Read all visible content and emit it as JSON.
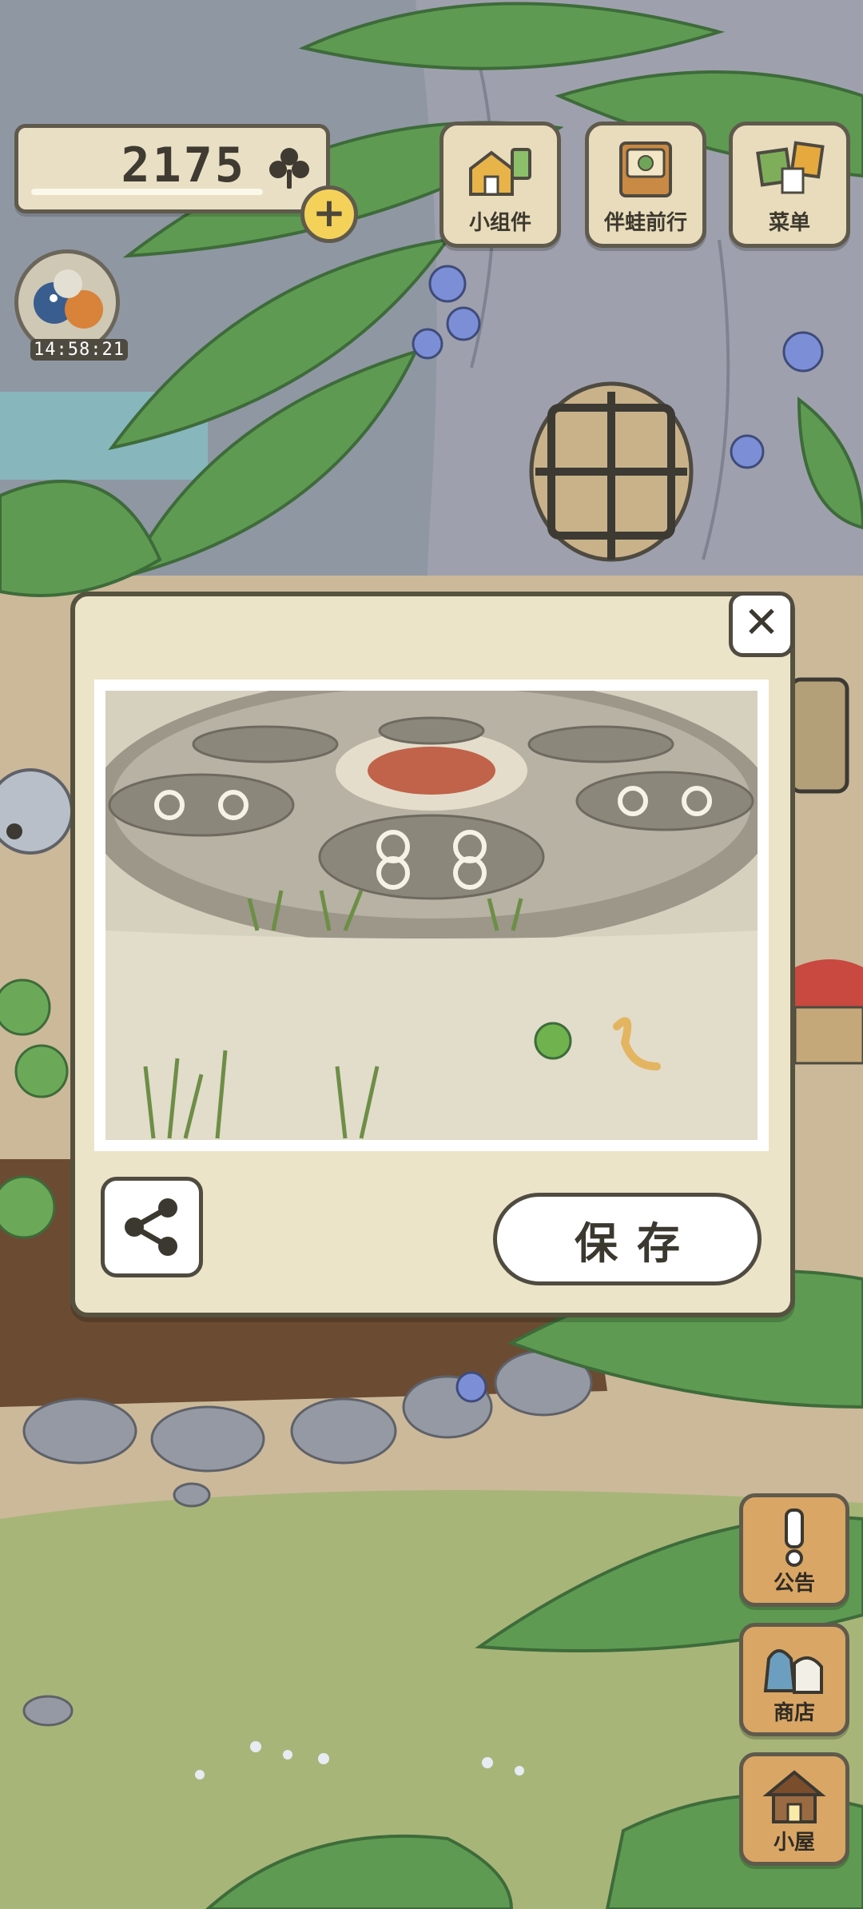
{
  "hud": {
    "clover_count": "2175",
    "timer": "14:58:21"
  },
  "top_buttons": [
    {
      "label": "小组件",
      "icon": "widget-icon"
    },
    {
      "label": "伴蛙前行",
      "icon": "frog-book-icon"
    },
    {
      "label": "菜单",
      "icon": "menu-cards-icon"
    }
  ],
  "side_buttons": [
    {
      "label": "公告",
      "icon": "exclamation-icon"
    },
    {
      "label": "商店",
      "icon": "shop-bags-icon"
    },
    {
      "label": "小屋",
      "icon": "house-icon"
    }
  ],
  "dialog": {
    "save_label": "保存"
  },
  "colors": {
    "panel": "#ece4c8",
    "border": "#55523f",
    "wood": "#d9a665",
    "plus": "#f4d25a"
  }
}
